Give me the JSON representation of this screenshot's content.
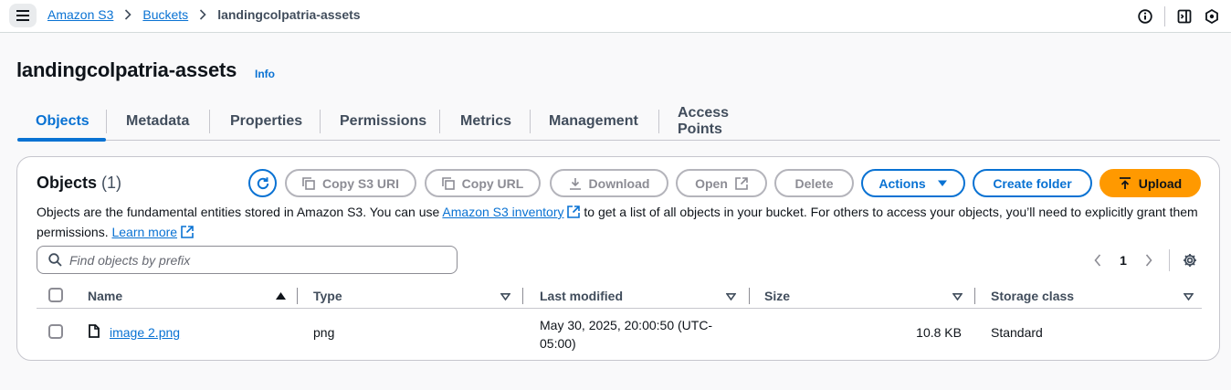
{
  "breadcrumb": {
    "items": [
      "Amazon S3",
      "Buckets"
    ],
    "current": "landingcolpatria-assets"
  },
  "page": {
    "title": "landingcolpatria-assets",
    "info": "Info"
  },
  "tabs": [
    "Objects",
    "Metadata",
    "Properties",
    "Permissions",
    "Metrics",
    "Management",
    "Access Points"
  ],
  "objects": {
    "title": "Objects",
    "count": "(1)",
    "description_before": "Objects are the fundamental entities stored in Amazon S3. You can use ",
    "inventory_link": "Amazon S3 inventory",
    "description_after": " to get a list of all objects in your bucket. For others to access your objects, you’ll need to explicitly grant them permissions. ",
    "learn_more": "Learn more"
  },
  "toolbar": {
    "copy_uri": "Copy S3 URI",
    "copy_url": "Copy URL",
    "download": "Download",
    "open": "Open",
    "delete": "Delete",
    "actions": "Actions",
    "create_folder": "Create folder",
    "upload": "Upload"
  },
  "search": {
    "placeholder": "Find objects by prefix"
  },
  "pagination": {
    "current_page": "1"
  },
  "table": {
    "columns": [
      "Name",
      "Type",
      "Last modified",
      "Size",
      "Storage class"
    ],
    "rows": [
      {
        "name": "image 2.png",
        "type": "png",
        "last_modified_line1": "May 30, 2025, 20:00:50 (UTC-",
        "last_modified_line2": "05:00)",
        "size": "10.8 KB",
        "storage_class": "Standard"
      }
    ]
  },
  "colors": {
    "link": "#0972d3",
    "upload": "#ff9900",
    "disabled": "#8c8c94"
  }
}
